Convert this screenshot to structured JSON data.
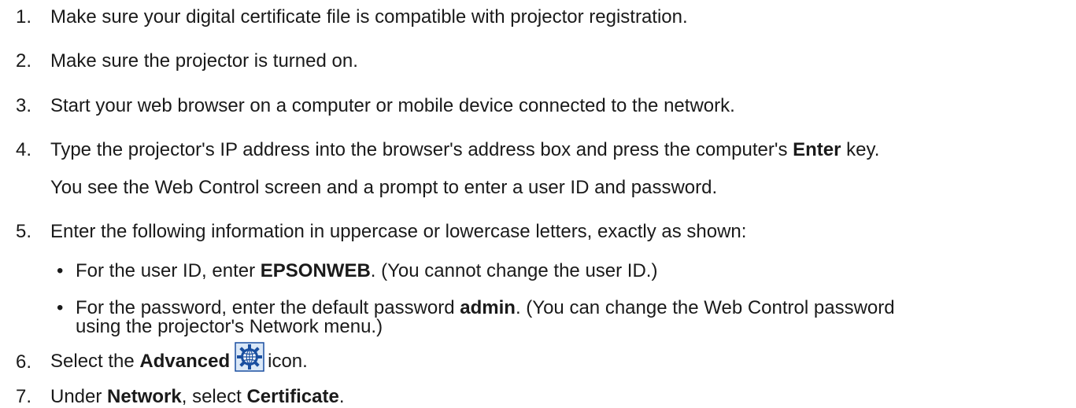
{
  "steps": [
    {
      "num": "1.",
      "text": "Make sure your digital certificate file is compatible with projector registration."
    },
    {
      "num": "2.",
      "text": "Make sure the projector is turned on."
    },
    {
      "num": "3.",
      "text": "Start your web browser on a computer or mobile device connected to the network."
    },
    {
      "num": "4.",
      "text_before": "Type the projector's IP address into the browser's address box and press the computer's ",
      "bold": "Enter",
      "text_after": " key."
    },
    {
      "num": "",
      "text": "You see the Web Control screen and a prompt to enter a user ID and password."
    },
    {
      "num": "5.",
      "text": "Enter the following information in uppercase or lowercase letters, exactly as shown:"
    },
    {
      "num": "6.",
      "text_before": "Select the ",
      "bold": "Advanced",
      "text_after": "icon."
    },
    {
      "num": "7.",
      "text_before": "Under ",
      "bold": "Network",
      "text_mid": ", select ",
      "bold2": "Certificate",
      "text_after": "."
    }
  ],
  "bullets": [
    {
      "marker": "•",
      "text_before": "For the user ID, enter ",
      "bold": "EPSONWEB",
      "text_after": ". (You cannot change the user ID.)"
    },
    {
      "marker": "•",
      "text_before": "For the password, enter the default password ",
      "bold": "admin",
      "text_after": ". (You can change the Web Control password",
      "text_line2": "using the projector's Network menu.)"
    }
  ],
  "icons": {
    "advanced": "advanced-globe-gear-icon"
  },
  "colors": {
    "icon_blue": "#1a4fa0",
    "icon_bg": "#dbe8f7"
  }
}
